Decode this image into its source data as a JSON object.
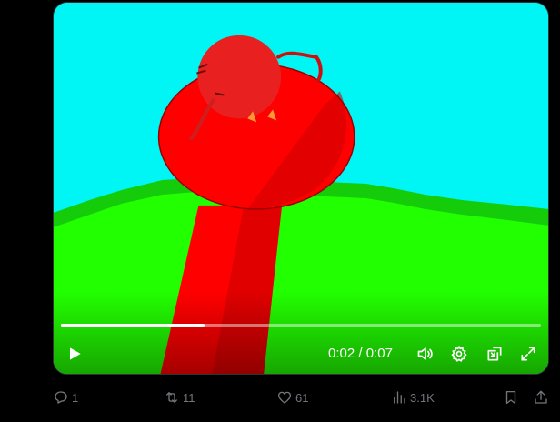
{
  "video": {
    "current_time": "0:02",
    "duration": "0:07",
    "time_separator": " / ",
    "progress": 0.3,
    "colors": {
      "sky": "#00f5f5",
      "grass": "#22ff00",
      "grass_dark": "#14cc0a",
      "mushroom": "#ff0000",
      "mushroom_dark": "#cc0000"
    }
  },
  "controls": {
    "play_icon": "play-icon",
    "volume_icon": "volume-icon",
    "settings_icon": "gear-icon",
    "pip_icon": "pip-icon",
    "fullscreen_icon": "expand-icon"
  },
  "actions": {
    "reply_count": "1",
    "retweet_count": "11",
    "like_count": "61",
    "views_count": "3.1K"
  }
}
